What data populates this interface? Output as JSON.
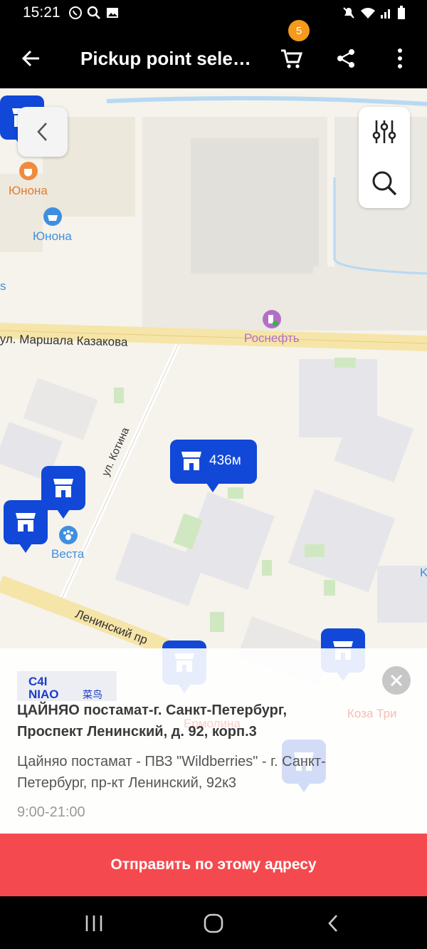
{
  "status": {
    "time": "15:21",
    "left_icons": [
      "whatsapp-icon",
      "search-icon",
      "image-icon"
    ],
    "right_icons": [
      "mute-icon",
      "wifi-icon",
      "signal-icon",
      "battery-icon"
    ]
  },
  "toolbar": {
    "title": "Pickup point sele…",
    "cart_count": "5"
  },
  "map": {
    "labels": {
      "yunona_cafe": "Юнона",
      "yunona_shop": "Юнона",
      "rosneft": "Роснефть",
      "street_kazakova": "ул. Маршала Казакова",
      "street_kotina": "ул. Котина",
      "street_leninsky": "Ленинский пр",
      "vesta": "Веста",
      "koza": "Коза Три",
      "edge_left": "s",
      "edge_right": "K",
      "faded": "Ермолина"
    },
    "selected_distance": "436м"
  },
  "sheet": {
    "logo_text": "CAINIAO 菜鸟",
    "title": "ЦАЙНЯО постамат-г. Санкт-Петербург, Проспект Ленинский, д. 92, корп.3",
    "address": "Цайняо постамат - ПВЗ \"Wildberries\" - г. Санкт-Петербург, пр-кт Ленинский, 92к3",
    "hours": "9:00-21:00"
  },
  "action": {
    "ship_label": "Отправить по этому адресу"
  },
  "colors": {
    "accent": "#f44a4f",
    "pin": "#1148d8",
    "badge": "#f59a1d"
  }
}
